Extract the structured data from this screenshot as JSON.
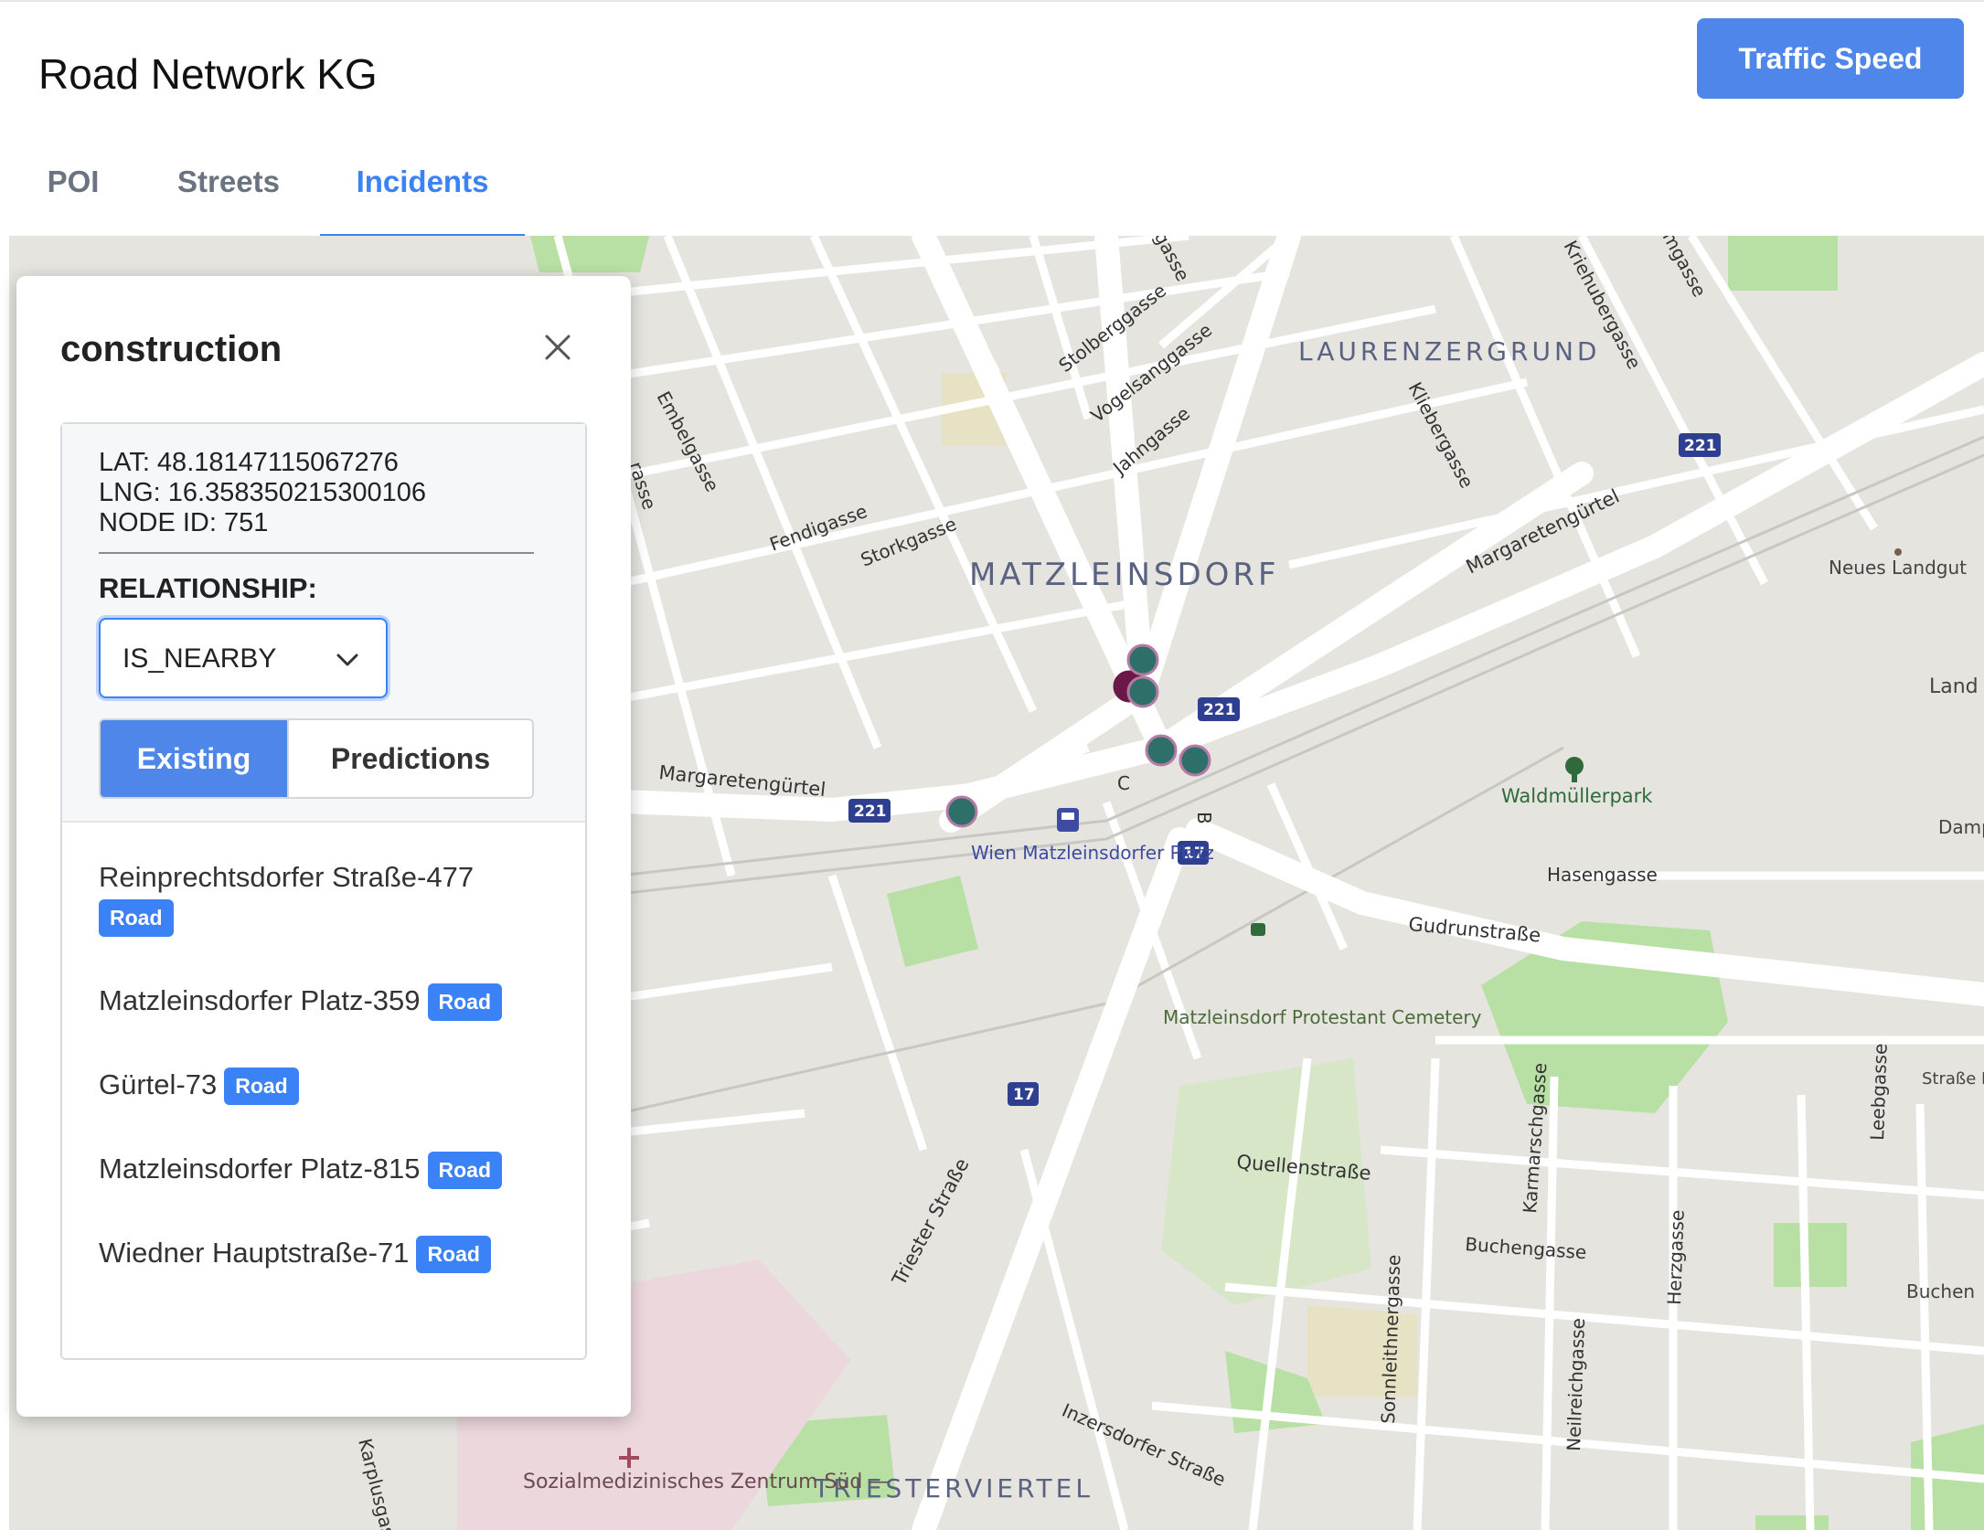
{
  "app": {
    "title": "Road Network KG",
    "traffic_button": "Traffic Speed"
  },
  "tabs": [
    {
      "label": "POI",
      "active": false
    },
    {
      "label": "Streets",
      "active": false
    },
    {
      "label": "Incidents",
      "active": true
    }
  ],
  "panel": {
    "title": "construction",
    "lat": "LAT: 48.18147115067276",
    "lng": "LNG: 16.358350215300106",
    "node_id": "NODE ID: 751",
    "relationship_label": "RELATIONSHIP:",
    "relationship_value": "IS_NEARBY",
    "segment": {
      "existing": "Existing",
      "predictions": "Predictions",
      "selected": "Existing"
    },
    "relations": [
      {
        "name": "Reinprechtsdorfer Straße-477",
        "type": "Road"
      },
      {
        "name": "Matzleinsdorfer Platz-359",
        "type": "Road"
      },
      {
        "name": "Gürtel-73",
        "type": "Road"
      },
      {
        "name": "Matzleinsdorfer Platz-815",
        "type": "Road"
      },
      {
        "name": "Wiedner Hauptstraße-71",
        "type": "Road"
      }
    ]
  },
  "map": {
    "district_labels": [
      "LAURENZERGRUND",
      "MATZLEINSDORF",
      "TRIESTERVIERTEL"
    ],
    "street_labels": [
      "Stolberggasse",
      "Vogelsanggasse",
      "Jahngasse",
      "Embelgasse",
      "Fendigasse",
      "Storkgasse",
      "Margaretengürtel",
      "Margaretengürtel",
      "Kliebergasse",
      "Kriehubergasse",
      "Gudrunstraße",
      "Hasengasse",
      "Quellenstraße",
      "Triester Straße",
      "Buchengasse",
      "Karmarschgasse",
      "Sonnleithnergasse",
      "Neilreichgasse",
      "Herzgasse",
      "Leebgasse",
      "Inzersdorfer Straße",
      "Karplusgasse",
      "gasse",
      "mgasse",
      "rasse"
    ],
    "place_labels": [
      "Waldmüllerpark",
      "Neues Landgut",
      "Land",
      "Damp",
      "Buchen",
      "Straße Betrieb Fav"
    ],
    "poi_labels": [
      "Wien Matzleinsdorfer Platz",
      "Matzleinsdorf Protestant Cemetery",
      "Sozialmedizinisches Zentrum Süd —"
    ],
    "road_shields": [
      "221",
      "221",
      "221",
      "17",
      "17"
    ],
    "junction_letters": [
      "C",
      "B"
    ],
    "colors": {
      "background": "#e6e4df",
      "park": "#b8e0a4",
      "hospital": "#ecd8dc",
      "road": "#ffffff",
      "marker_fill": "#2f6f6a",
      "marker_border": "#b57aa6",
      "marker_dark": "#6b1848",
      "shield": "#2f3f8f"
    }
  }
}
